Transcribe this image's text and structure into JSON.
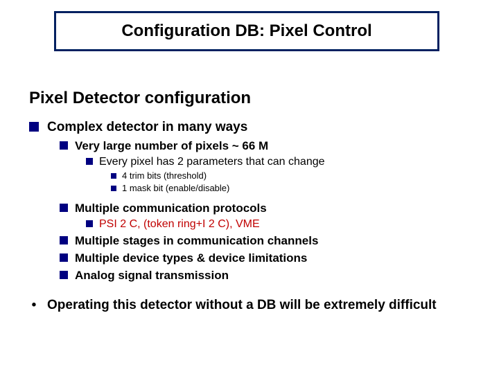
{
  "title": "Configuration DB: Pixel Control",
  "subtitle": "Pixel Detector configuration",
  "b1": "Complex detector in many ways",
  "b1_1": "Very large number of pixels ~ 66 M",
  "b1_1_1": "Every pixel has 2 parameters that can change",
  "b1_1_1_1": "4 trim bits (threshold)",
  "b1_1_1_2": "1 mask bit (enable/disable)",
  "b1_2": "Multiple communication protocols",
  "b1_2_1": "PSI 2 C, (token ring+I 2 C), VME",
  "b1_3": "Multiple stages in communication channels",
  "b1_4": "Multiple device types & device limitations",
  "b1_5": "Analog signal transmission",
  "footnote": "Operating this detector without a DB will be extremely difficult"
}
